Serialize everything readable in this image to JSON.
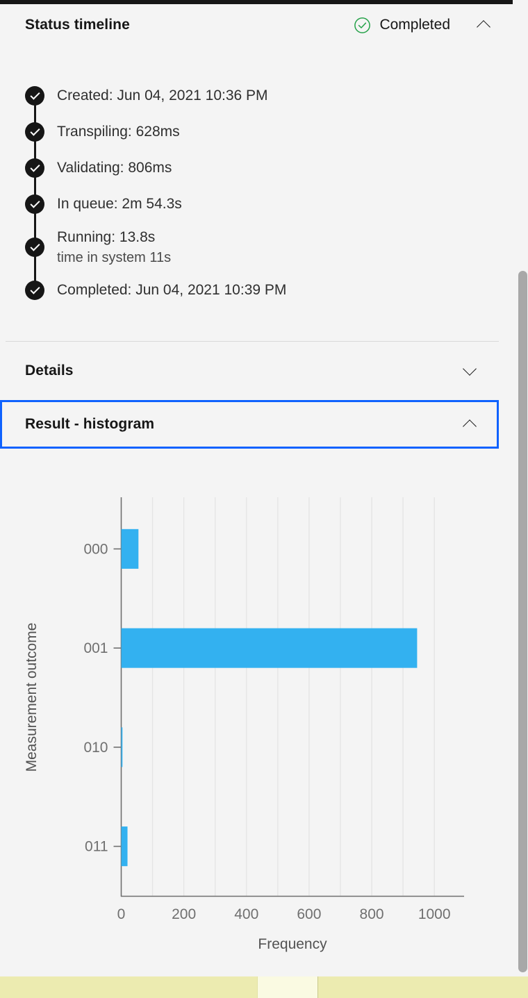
{
  "theme": {
    "bg": "#f4f4f4",
    "text": "#161616",
    "accent_blue": "#0f62fe",
    "bar_blue": "#33b1f0",
    "status_green": "#24a148",
    "scrollbar": "#a8a8a8",
    "bottom_strip": "#ecebb0"
  },
  "status_timeline": {
    "title": "Status timeline",
    "status_label": "Completed",
    "status_icon": "check-circle-green",
    "expanded": true,
    "chevron_icon": "chevron-up-icon",
    "items": [
      {
        "label": "Created: Jun 04, 2021 10:36 PM",
        "sub": ""
      },
      {
        "label": "Transpiling: 628ms",
        "sub": ""
      },
      {
        "label": "Validating: 806ms",
        "sub": ""
      },
      {
        "label": "In queue: 2m 54.3s",
        "sub": ""
      },
      {
        "label": "Running: 13.8s",
        "sub": "time in system 11s"
      },
      {
        "label": "Completed: Jun 04, 2021 10:39 PM",
        "sub": ""
      }
    ]
  },
  "details_section": {
    "title": "Details",
    "expanded": false,
    "chevron_icon": "chevron-down-icon"
  },
  "histogram_section": {
    "title": "Result - histogram",
    "expanded": true,
    "focused": true,
    "chevron_icon": "chevron-up-icon"
  },
  "chart_data": {
    "type": "bar",
    "orientation": "horizontal",
    "title": "",
    "xlabel": "Frequency",
    "ylabel": "Measurement outcome",
    "categories": [
      "000",
      "001",
      "010",
      "011"
    ],
    "values": [
      55,
      945,
      4,
      20
    ],
    "xlim": [
      0,
      1095
    ],
    "xticks": [
      0,
      200,
      400,
      600,
      800,
      1000
    ],
    "xticklabels": [
      "0",
      "200",
      "400",
      "600",
      "800",
      "1000"
    ],
    "gridline_step": 100,
    "grid": true,
    "legend": false,
    "bar_color": "#33b1f0"
  },
  "scrollbar": {
    "name": "vertical-scrollbar",
    "thumb_position_pct": 27
  }
}
